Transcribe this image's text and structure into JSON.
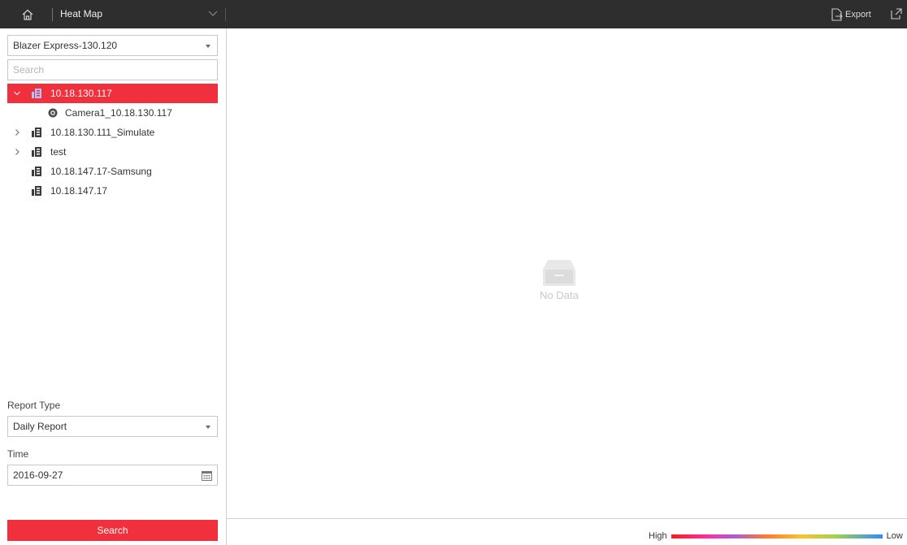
{
  "header": {
    "title": "Heat Map",
    "export_label": "Export"
  },
  "left_panel": {
    "site_select": "Blazer Express-130.120",
    "search_placeholder": "Search",
    "tree": [
      {
        "label": "10.18.130.117",
        "expanded": true,
        "selected": true,
        "icon": "device-icon"
      },
      {
        "label": "Camera1_10.18.130.117",
        "child": true,
        "icon": "camera-icon"
      },
      {
        "label": "10.18.130.111_Simulate",
        "expandable": true,
        "icon": "device-icon"
      },
      {
        "label": "test",
        "expandable": true,
        "icon": "device-icon"
      },
      {
        "label": "10.18.147.17-Samsung",
        "icon": "device-icon"
      },
      {
        "label": "10.18.147.17",
        "icon": "device-icon"
      }
    ],
    "report_type_label": "Report Type",
    "report_type_value": "Daily Report",
    "time_label": "Time",
    "time_value": "2016-09-27",
    "search_button": "Search"
  },
  "main": {
    "no_data": "No Data",
    "legend_high": "High",
    "legend_low": "Low"
  },
  "colors": {
    "accent": "#f0303c",
    "topbar": "#2e2e2e"
  }
}
